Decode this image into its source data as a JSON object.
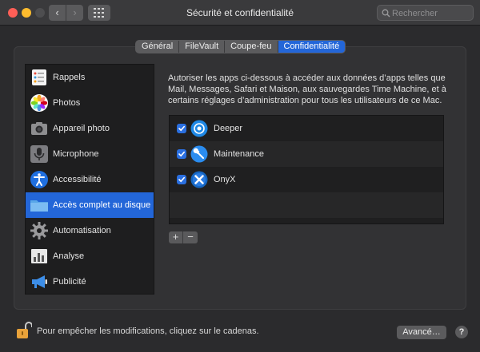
{
  "window": {
    "title": "Sécurité et confidentialité",
    "search_placeholder": "Rechercher"
  },
  "tabs": [
    {
      "label": "Général"
    },
    {
      "label": "FileVault"
    },
    {
      "label": "Coupe-feu"
    },
    {
      "label": "Confidentialité"
    }
  ],
  "sidebar": {
    "items": [
      {
        "label": "Rappels",
        "icon": "reminders-icon"
      },
      {
        "label": "Photos",
        "icon": "photos-icon"
      },
      {
        "label": "Appareil photo",
        "icon": "camera-icon"
      },
      {
        "label": "Microphone",
        "icon": "microphone-icon"
      },
      {
        "label": "Accessibilité",
        "icon": "accessibility-icon"
      },
      {
        "label": "Accès complet au disque",
        "icon": "folder-icon"
      },
      {
        "label": "Automatisation",
        "icon": "gear-icon"
      },
      {
        "label": "Analyse",
        "icon": "analytics-icon"
      },
      {
        "label": "Publicité",
        "icon": "megaphone-icon"
      }
    ],
    "selected": "Accès complet au disque"
  },
  "main": {
    "description": "Autoriser les apps ci-dessous à accéder aux données d’apps telles que Mail, Messages, Safari et Maison, aux sauvegardes Time Machine, et à certains réglages d’administration pour tous les utilisateurs de ce Mac.",
    "apps": [
      {
        "name": "Deeper",
        "checked": true,
        "icon": "deeper-icon"
      },
      {
        "name": "Maintenance",
        "checked": true,
        "icon": "maintenance-icon"
      },
      {
        "name": "OnyX",
        "checked": true,
        "icon": "onyx-icon"
      }
    ],
    "add_label": "+",
    "remove_label": "−"
  },
  "footer": {
    "lock_text": "Pour empêcher les modifications, cliquez sur le cadenas.",
    "advanced_label": "Avancé…",
    "help_label": "?"
  },
  "colors": {
    "accent": "#2366d8",
    "window_bg": "#2b2b2d",
    "lock": "#e8a23a"
  }
}
